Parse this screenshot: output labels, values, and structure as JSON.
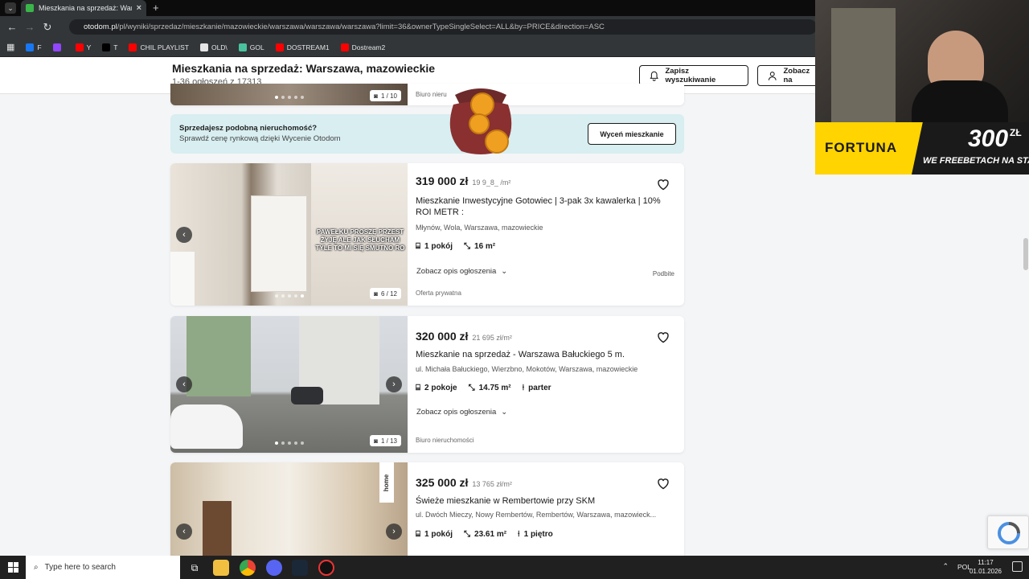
{
  "browser": {
    "tab_title": "Mieszkania na sprzedaż: Warsza",
    "url_domain": "otodom.pl",
    "url_path": "/pl/wyniki/sprzedaz/mieszkanie/mazowieckie/warszawa/warszawa/warszawa?limit=36&ownerTypeSingleSelect=ALL&by=PRICE&direction=ASC",
    "bookmarks": [
      {
        "label": "F",
        "color": "#1877f2"
      },
      {
        "label": "",
        "color": "#9146ff"
      },
      {
        "label": "Y",
        "color": "#ff0000"
      },
      {
        "label": "T",
        "color": "#000000"
      },
      {
        "label": "CHIL PLAYLIST",
        "color": "#ff0000"
      },
      {
        "label": "OLD\\",
        "color": "#e5e5e5"
      },
      {
        "label": "GOL",
        "color": "#49c39e"
      },
      {
        "label": "DOSTREAM1",
        "color": "#ff0000"
      },
      {
        "label": "Dostream2",
        "color": "#ff0000"
      }
    ]
  },
  "header": {
    "title": "Mieszkania na sprzedaż: Warszawa, mazowieckie",
    "count": "1-36 ogłoszeń z 17313",
    "save_search": "Zapisz wyszukiwanie",
    "see_more": "Zobacz na"
  },
  "top_card": {
    "counter": "1 / 10",
    "agency": "Biuro nieru"
  },
  "banner": {
    "title": "Sprzedajesz podobną nieruchomość?",
    "subtitle": "Sprawdź cenę rynkową dzięki Wycenie Otodom",
    "button": "Wyceń mieszkanie"
  },
  "listings": [
    {
      "price": "319 000 zł",
      "price_per_m2": "19 9_8_ /m²",
      "title": "Mieszkanie Inwestycyjne Gotowiec | 3-pak 3x kawalerka | 10% ROI METR :",
      "address": "Młynów, Wola, Warszawa, mazowieckie",
      "rooms": "1 pokój",
      "area": "16 m²",
      "floor": "",
      "description_link": "Zobacz opis ogłoszenia",
      "owner": "Oferta prywatna",
      "bumped": "Podbite",
      "counter": "6 / 12"
    },
    {
      "price": "320 000 zł",
      "price_per_m2": "21 695 zł/m²",
      "title": "Mieszkanie na sprzedaż - Warszawa Bałuckiego 5 m.",
      "address": "ul. Michała Bałuckiego, Wierzbno, Mokotów, Warszawa, mazowieckie",
      "rooms": "2 pokoje",
      "area": "14.75 m²",
      "floor": "parter",
      "description_link": "Zobacz opis ogłoszenia",
      "owner": "Biuro nieruchomości",
      "bumped": "",
      "counter": "1 / 13"
    },
    {
      "price": "325 000 zł",
      "price_per_m2": "13 765 zł/m²",
      "title": "Świeże mieszkanie w Rembertowie przy SKM",
      "address": "ul. Dwóch Mieczy, Nowy Rembertów, Rembertów, Warszawa, mazowieck...",
      "rooms": "1 pokój",
      "area": "23.61 m²",
      "floor": "1 piętro",
      "description_link": "",
      "owner": "",
      "bumped": "",
      "counter": "",
      "badge": "home"
    }
  ],
  "stream_overlay": {
    "chat_text": "PAWEŁKU PROSZĘ PRZEST ŻYJĘ ALE JAK SŁUCHAM TYLE TO MI SIĘ SMUTNO RO",
    "fortuna_logo": "FORTUNA",
    "fortuna_amount": "300",
    "fortuna_currency": "ZŁ",
    "fortuna_line": "WE FREEBETACH NA STAR"
  },
  "taskbar": {
    "search_placeholder": "Type here to search",
    "language": "POL",
    "time": "11:17",
    "date": "01.01.2026"
  }
}
